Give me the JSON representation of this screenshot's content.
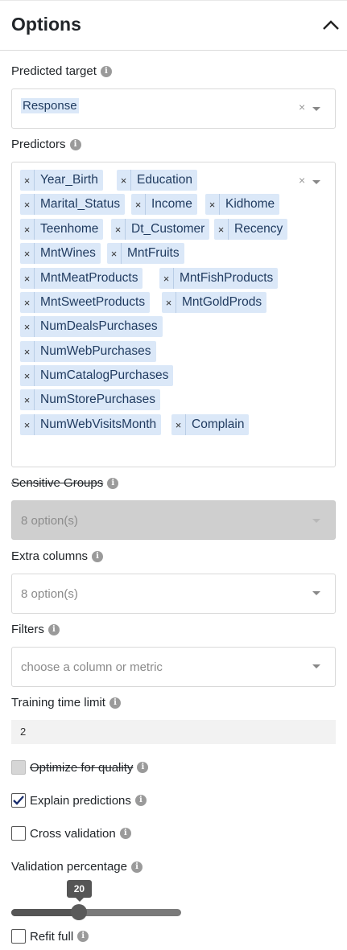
{
  "header": {
    "title": "Options"
  },
  "predicted_target": {
    "label": "Predicted target",
    "value": "Response",
    "clear": "×"
  },
  "predictors": {
    "label": "Predictors",
    "clear": "×",
    "chip_remove": "×",
    "chips": [
      "Year_Birth",
      "Education",
      "Marital_Status",
      "Income",
      "Kidhome",
      "Teenhome",
      "Dt_Customer",
      "Recency",
      "MntWines",
      "MntFruits",
      "MntMeatProducts",
      "MntFishProducts",
      "MntSweetProducts",
      "MntGoldProds",
      "NumDealsPurchases",
      "NumWebPurchases",
      "NumCatalogPurchases",
      "NumStorePurchases",
      "NumWebVisitsMonth",
      "Complain"
    ]
  },
  "sensitive_groups": {
    "label": "Sensitive Groups",
    "value": "8 option(s)"
  },
  "extra_columns": {
    "label": "Extra columns",
    "value": "8 option(s)"
  },
  "filters": {
    "label": "Filters",
    "placeholder": "choose a column or metric"
  },
  "training_time_limit": {
    "label": "Training time limit",
    "value": "2"
  },
  "optimize_for_quality": {
    "label": "Optimize for quality",
    "checked": false
  },
  "explain_predictions": {
    "label": "Explain predictions",
    "checked": true
  },
  "cross_validation": {
    "label": "Cross validation",
    "checked": false
  },
  "validation_percentage": {
    "label": "Validation percentage",
    "value": "20",
    "percent": 20
  },
  "refit_full": {
    "label": "Refit full",
    "checked": false
  },
  "icons": {
    "info": "info-icon",
    "collapse": "chevron-up-icon",
    "dropdown": "caret-down-icon",
    "check": "checkmark-icon"
  }
}
